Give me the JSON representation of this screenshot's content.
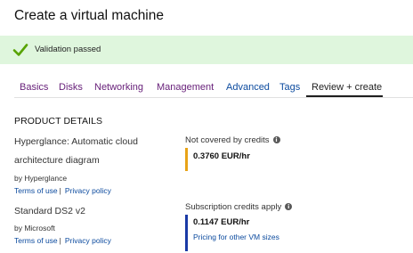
{
  "page": {
    "title": "Create a virtual machine"
  },
  "validation": {
    "text": "Validation passed",
    "color": "#dff6dd",
    "icon": "checkmark-icon"
  },
  "tabs": [
    {
      "label": "Basics",
      "state": "visited"
    },
    {
      "label": "Disks",
      "state": "visited"
    },
    {
      "label": "Networking",
      "state": "visited"
    },
    {
      "label": "Management",
      "state": "visited"
    },
    {
      "label": "Advanced",
      "state": "link"
    },
    {
      "label": "Tags",
      "state": "link"
    },
    {
      "label": "Review + create",
      "state": "active"
    }
  ],
  "product_details": {
    "heading": "PRODUCT DETAILS",
    "items": [
      {
        "name_line1": "Hyperglance: Automatic cloud",
        "name_line2": "architecture diagram",
        "by": "by Hyperglance",
        "terms": "Terms of use",
        "sep": "|",
        "privacy": "Privacy policy",
        "price_label": "Not covered by credits",
        "price": "0.3760 EUR/hr",
        "accent": "#e8a317"
      },
      {
        "name_line1": "Standard DS2 v2",
        "by": "by Microsoft",
        "terms": "Terms of use",
        "sep": "|",
        "privacy": "Privacy policy",
        "price_label": "Subscription credits apply",
        "price": "0.1147 EUR/hr",
        "price_link": "Pricing for other VM sizes",
        "accent": "#1a3aa6"
      }
    ]
  }
}
